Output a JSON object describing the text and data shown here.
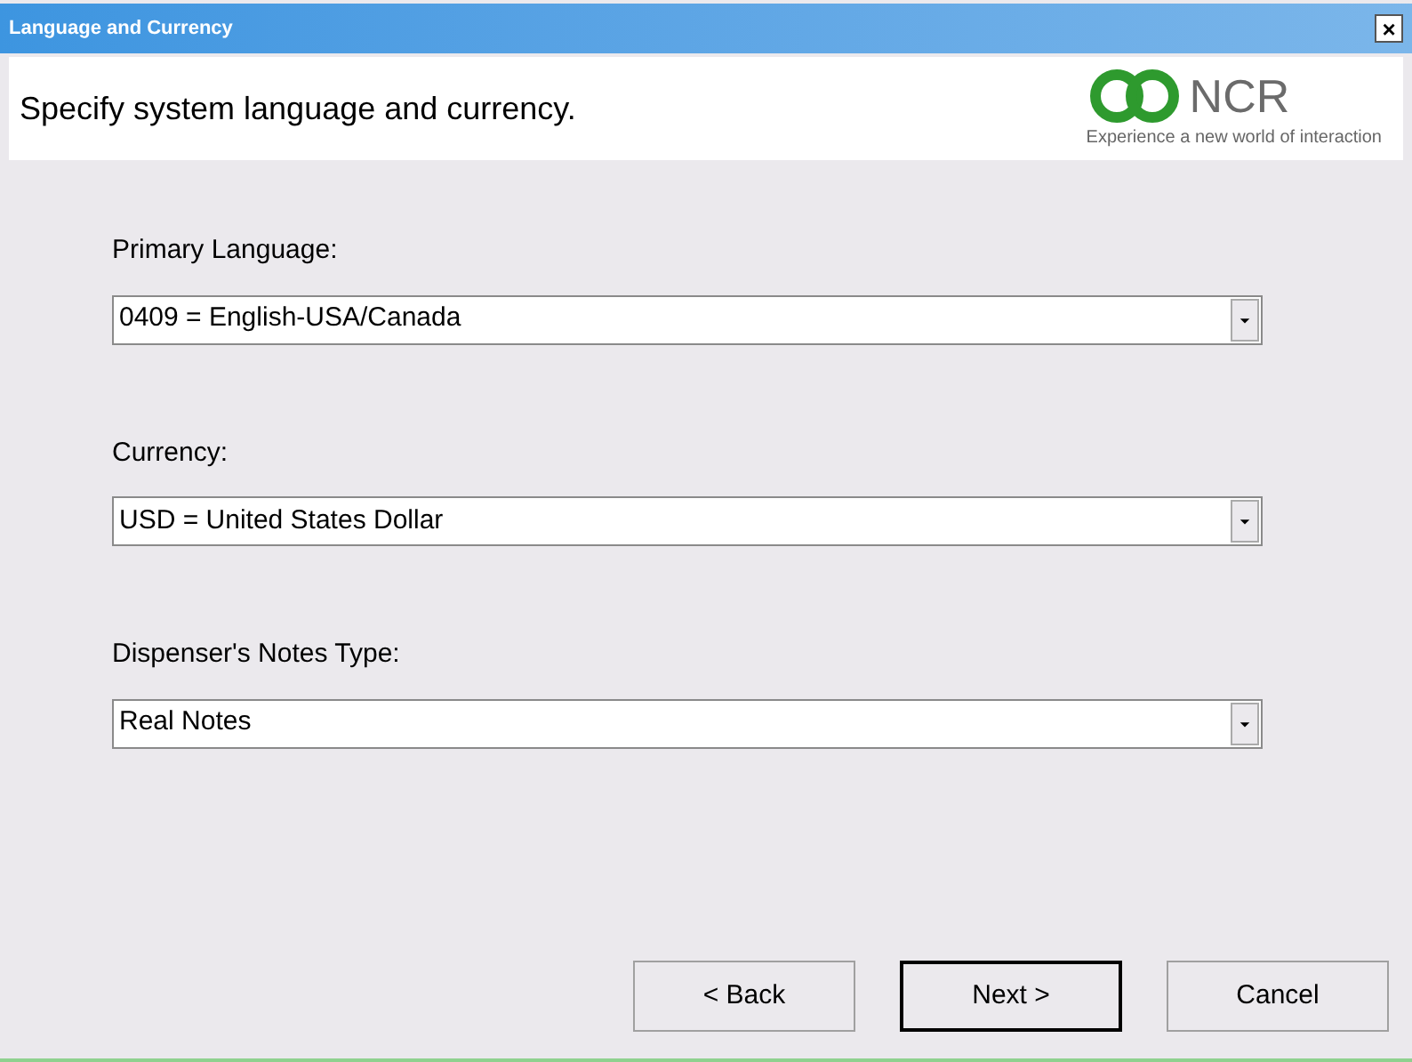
{
  "window": {
    "title": "Language and Currency",
    "close": "×"
  },
  "header": {
    "text": "Specify system language and currency.",
    "logo_name": "NCR",
    "tagline": "Experience a new world of interaction"
  },
  "fields": [
    {
      "label": "Primary Language:",
      "value": "0409 = English-USA/Canada"
    },
    {
      "label": "Currency:",
      "value": "USD = United States Dollar"
    },
    {
      "label": "Dispenser's Notes Type:",
      "value": "Real Notes"
    }
  ],
  "buttons": [
    {
      "label": "< Back",
      "default": false
    },
    {
      "label": "Next >",
      "default": true
    },
    {
      "label": "Cancel",
      "default": false
    }
  ]
}
